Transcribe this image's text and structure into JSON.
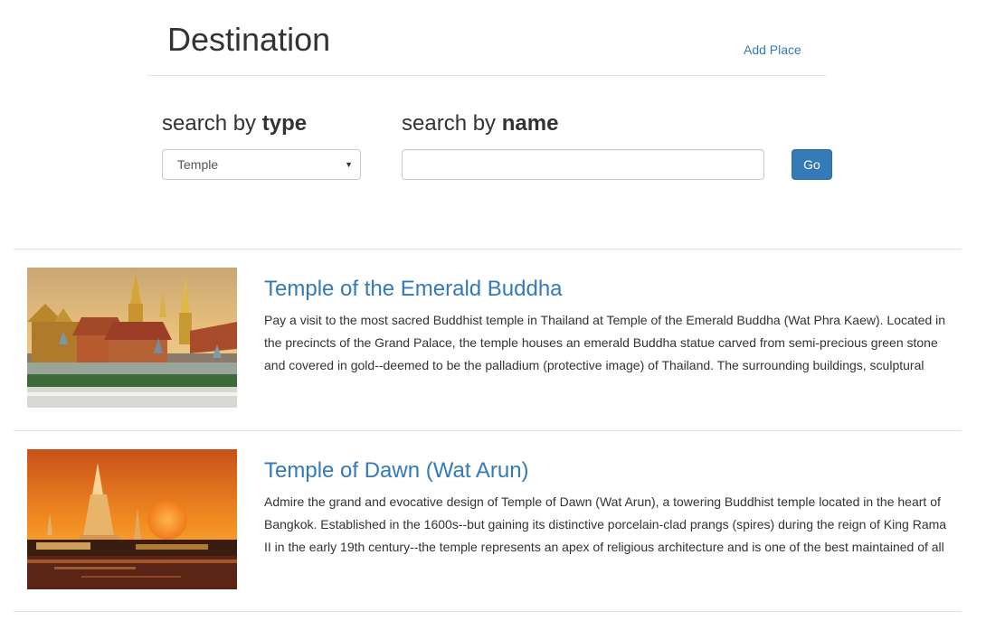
{
  "header": {
    "title": "Destination",
    "add_place_label": "Add Place"
  },
  "search": {
    "type_heading_prefix": "search by",
    "type_heading_bold": "type",
    "type_selected": "Temple",
    "name_heading_prefix": "search by",
    "name_heading_bold": "name",
    "name_value": "",
    "go_label": "Go"
  },
  "results": [
    {
      "title": "Temple of the Emerald Buddha",
      "description": "Pay a visit to the most sacred Buddhist temple in Thailand at Temple of the Emerald Buddha (Wat Phra Kaew). Located in the precincts of the Grand Palace, the temple houses an emerald Buddha statue carved from semi-precious green stone and covered in gold--deemed to be the palladium (protective image) of Thailand. The surrounding buildings, sculptural"
    },
    {
      "title": "Temple of Dawn (Wat Arun)",
      "description": "Admire the grand and evocative design of Temple of Dawn (Wat Arun), a towering Buddhist temple located in the heart of Bangkok. Established in the 1600s--but gaining its distinctive porcelain-clad prangs (spires) during the reign of King Rama II in the early 19th century--the temple represents an apex of religious architecture and is one of the best maintained of all"
    }
  ],
  "colors": {
    "link": "#337ab7",
    "primary_button": "#337ab7",
    "border": "#e5e5e5"
  }
}
